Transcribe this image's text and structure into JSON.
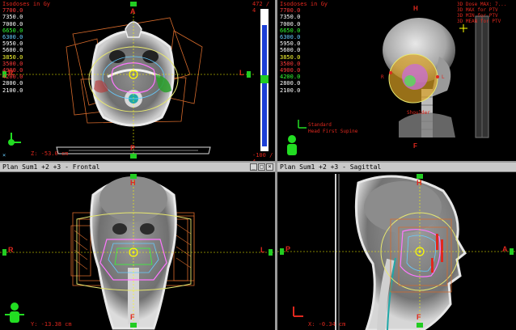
{
  "axial": {
    "legend_title": "Isodoses in Gy",
    "isodoses": [
      {
        "value": "7700.0",
        "color": "#ff3b3b"
      },
      {
        "value": "7350.0",
        "color": "#ffffff"
      },
      {
        "value": "7000.0",
        "color": "#ffffff"
      },
      {
        "value": "6650.0",
        "color": "#33ff33"
      },
      {
        "value": "6300.0",
        "color": "#66ccff"
      },
      {
        "value": "5950.0",
        "color": "#ffffff"
      },
      {
        "value": "5600.0",
        "color": "#ffffff"
      },
      {
        "value": "3850.0",
        "color": "#ffff33"
      },
      {
        "value": "3500.0",
        "color": "#ff3b3b"
      },
      {
        "value": "4900.0",
        "color": "#ff3b3b"
      },
      {
        "value": "4200.0",
        "color": "#ff3b3b"
      },
      {
        "value": "2800.0",
        "color": "#ffffff"
      },
      {
        "value": "2100.0",
        "color": "#ffffff"
      }
    ],
    "orient_top": "A",
    "orient_bottom": "P",
    "orient_left": "R",
    "orient_right": "L",
    "coord": "Z: -53.0 cm",
    "ww_top": "472 / 4",
    "ww_bottom": "-100 / 4"
  },
  "view3d": {
    "legend_title": "Isodoses in Gy",
    "isodoses": [
      {
        "value": "7700.0",
        "color": "#ff3b3b"
      },
      {
        "value": "7350.0",
        "color": "#ffffff"
      },
      {
        "value": "7000.0",
        "color": "#ffffff"
      },
      {
        "value": "6650.0",
        "color": "#33ff33"
      },
      {
        "value": "6300.0",
        "color": "#66ccff"
      },
      {
        "value": "5950.0",
        "color": "#ffffff"
      },
      {
        "value": "5600.0",
        "color": "#ffffff"
      },
      {
        "value": "3850.0",
        "color": "#ffff33"
      },
      {
        "value": "3500.0",
        "color": "#ff3b3b"
      },
      {
        "value": "4900.0",
        "color": "#ff3b3b"
      },
      {
        "value": "4200.0",
        "color": "#33ff33"
      },
      {
        "value": "2800.0",
        "color": "#ffffff"
      },
      {
        "value": "2100.0",
        "color": "#ffffff"
      }
    ],
    "dose_legend": [
      "3D Dose MAX: 7...",
      "3D MAX for PTV",
      "3D MIN for PTV",
      "3D MEAN for PTV"
    ],
    "orient_top": "H",
    "orient_bottom": "F",
    "standard": "Standard",
    "head_first": "Head First Supine",
    "label_left": "R",
    "label_right": "L",
    "shoulder": "Shoulder"
  },
  "frontal": {
    "title": "Plan Sum1 +2 +3 - Frontal",
    "orient_top": "H",
    "orient_bottom": "F",
    "orient_left": "R",
    "orient_right": "L",
    "coord": "Y: -13.38 cm"
  },
  "sagittal": {
    "title": "Plan Sum1 +2 +3 - Sagittal",
    "orient_top": "H",
    "orient_bottom": "F",
    "orient_left": "P",
    "orient_right": "A",
    "coord": "X: -0.34 cm"
  },
  "colors": {
    "cross": "#ffff00",
    "ptv": "#ff77ff",
    "beam": "#d66a2b",
    "outline": "#e8e870",
    "orient": "#e0281e",
    "triad_green": "#22dd22"
  }
}
